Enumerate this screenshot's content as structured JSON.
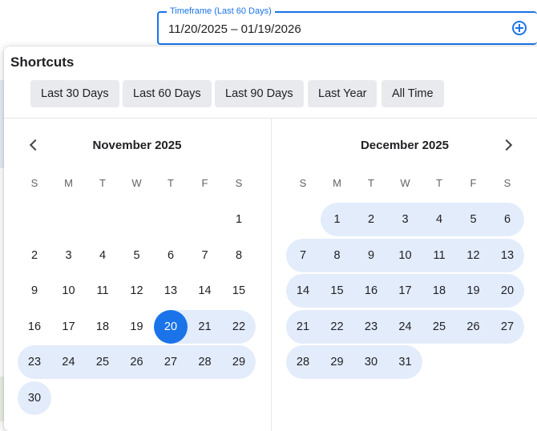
{
  "timeframe": {
    "label": "Timeframe (Last 60 Days)",
    "value": "11/20/2025 – 01/19/2026",
    "add_icon": "add-circle-icon",
    "accent_color": "#1a73e8"
  },
  "shortcuts": {
    "title": "Shortcuts",
    "items": [
      "Last 30 Days",
      "Last 60 Days",
      "Last 90 Days",
      "Last Year",
      "All Time"
    ]
  },
  "calendar": {
    "weekdays": [
      "S",
      "M",
      "T",
      "W",
      "T",
      "F",
      "S"
    ],
    "range_color": "#e3ecfb",
    "selected_color": "#1a73e8",
    "months": [
      {
        "title": "November 2025",
        "nav_icon": "chevron-left-icon",
        "first_weekday": 6,
        "days": 30,
        "selected_day": 20,
        "range_start": 20,
        "range_end": 30
      },
      {
        "title": "December 2025",
        "nav_icon": "chevron-right-icon",
        "first_weekday": 1,
        "days": 31,
        "selected_day": null,
        "range_start": 1,
        "range_end": 31
      }
    ]
  }
}
